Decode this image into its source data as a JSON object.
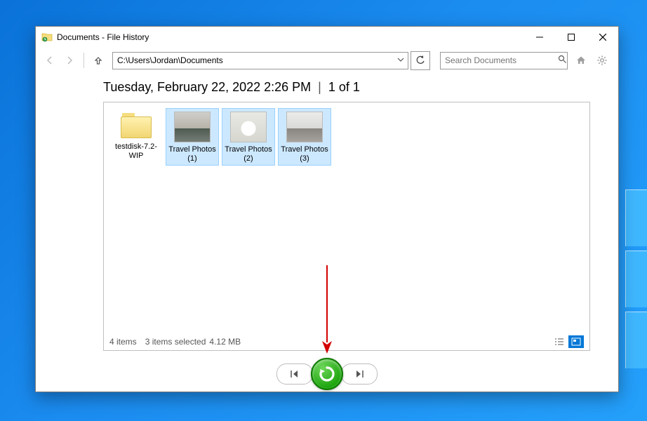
{
  "window": {
    "title": "Documents - File History"
  },
  "nav": {
    "path": "C:\\Users\\Jordan\\Documents",
    "search_placeholder": "Search Documents"
  },
  "heading": {
    "timestamp": "Tuesday, February 22, 2022 2:26 PM",
    "page_indicator": "1 of 1"
  },
  "items": [
    {
      "label": "testdisk-7.2-WIP",
      "type": "folder",
      "selected": false
    },
    {
      "label": "Travel Photos (1)",
      "type": "image",
      "thumbClass": "ph1",
      "selected": true
    },
    {
      "label": "Travel Photos (2)",
      "type": "image",
      "thumbClass": "ph2",
      "selected": true
    },
    {
      "label": "Travel Photos (3)",
      "type": "image",
      "thumbClass": "ph3",
      "selected": true
    }
  ],
  "status": {
    "item_count": "4 items",
    "selection": "3 items selected",
    "size": "4.12 MB"
  }
}
